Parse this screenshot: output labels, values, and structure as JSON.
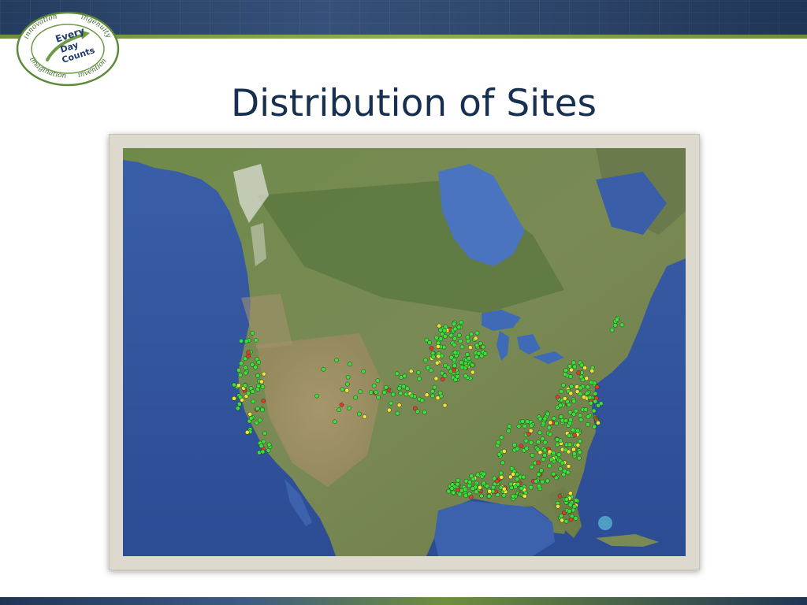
{
  "slide": {
    "title": "Distribution of Sites"
  },
  "logo": {
    "words": [
      "innovation",
      "ingenuity",
      "invention",
      "imagination"
    ],
    "center": [
      "Every",
      "Day",
      "Counts"
    ]
  },
  "map": {
    "region": "North America (satellite view)",
    "marker_colors": {
      "green": "#3be03b",
      "yellow": "#f2e23a",
      "red": "#e23a2e"
    }
  },
  "colors": {
    "title": "#17304f",
    "banner": "#243c5e",
    "accent_green": "#6f8f3c"
  }
}
